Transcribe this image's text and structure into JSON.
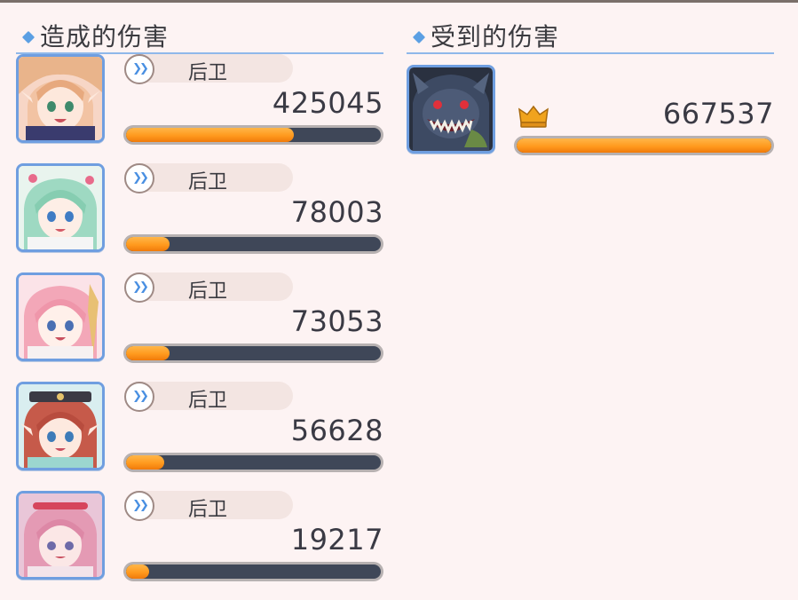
{
  "dealt": {
    "title": "造成的伤害",
    "entries": [
      {
        "icon": "elf-pink-hair-portrait-icon",
        "role": "后卫",
        "value": "425045",
        "share": 0.66
      },
      {
        "icon": "mint-hair-girl-portrait-icon",
        "role": "后卫",
        "value": "78003",
        "share": 0.17
      },
      {
        "icon": "pink-hair-girl-portrait-icon",
        "role": "后卫",
        "value": "73053",
        "share": 0.17
      },
      {
        "icon": "red-hair-elf-portrait-icon",
        "role": "后卫",
        "value": "56628",
        "share": 0.15
      },
      {
        "icon": "rose-hair-girl-portrait-icon",
        "role": "后卫",
        "value": "19217",
        "share": 0.09
      }
    ]
  },
  "received": {
    "title": "受到的伤害",
    "entries": [
      {
        "icon": "dark-dragon-monster-portrait-icon",
        "crown_icon": "crown-icon",
        "value": "667537",
        "share": 1.0
      }
    ]
  },
  "colors": {
    "accent": "#5b9fe3",
    "bar_fill": "#ff9a1e",
    "bar_track": "#3f4758",
    "frame": "#6f9ee0"
  }
}
